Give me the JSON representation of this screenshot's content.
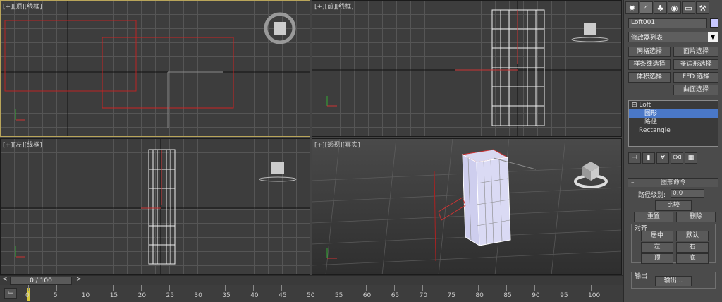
{
  "viewports": {
    "top": {
      "label_plus": "[+]",
      "label_view": "[顶]",
      "label_mode": "[线框]"
    },
    "front": {
      "label_plus": "[+]",
      "label_view": "[前]",
      "label_mode": "[线框]"
    },
    "left": {
      "label_plus": "[+]",
      "label_view": "[左]",
      "label_mode": "[线框]"
    },
    "persp": {
      "label_plus": "[+]",
      "label_view": "[透视]",
      "label_mode": "[真实]"
    }
  },
  "panel": {
    "object_name": "Loft001",
    "modifier_list": "修改器列表",
    "buttons": [
      "网格选择",
      "面片选择",
      "样条线选择",
      "多边形选择",
      "体积选择",
      "FFD 选择",
      "曲面选择"
    ],
    "stack": [
      "Loft",
      "图形",
      "路径",
      "Rectangle"
    ],
    "rollout_title": "图形命令",
    "path_level_label": "路径级别:",
    "path_level_value": "0.0",
    "compare": "比较",
    "reset": "重置",
    "delete": "删除",
    "align_title": "对齐",
    "align": [
      "居中",
      "默认",
      "左",
      "右",
      "顶",
      "底"
    ],
    "output_title": "输出",
    "output_btn": "输出..."
  },
  "timeline": {
    "frame": "0 / 100"
  },
  "ruler": [
    "0",
    "5",
    "10",
    "15",
    "20",
    "25",
    "30",
    "35",
    "40",
    "45",
    "50",
    "55",
    "60",
    "65",
    "70",
    "75",
    "80",
    "85",
    "90",
    "95",
    "100"
  ]
}
